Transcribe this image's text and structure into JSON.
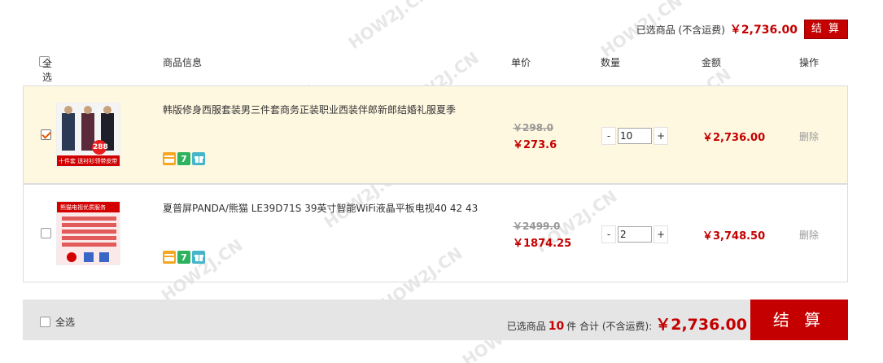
{
  "top_summary": {
    "label": "已选商品 (不含运费)",
    "amount": "￥2,736.00",
    "button": "结 算"
  },
  "header": {
    "select_all": "全选",
    "product_info": "商品信息",
    "unit_price": "单价",
    "quantity": "数量",
    "amount": "金额",
    "operation": "操作"
  },
  "items": [
    {
      "title": "韩版修身西服套装男三件套商务正装职业西装伴郎新郎结婚礼服夏季",
      "orig_price": "￥298.0",
      "price": "￥273.6",
      "qty": "10",
      "sum": "￥2,736.00",
      "delete": "删除",
      "checked": true,
      "thumb_text_1": "288",
      "thumb_text_2": "十件套 送衬衫领带皮带"
    },
    {
      "title": "夏普屏PANDA/熊猫 LE39D71S 39英寸智能WiFi液晶平板电视40 42 43",
      "orig_price": "￥2499.0",
      "price": "￥1874.25",
      "qty": "2",
      "sum": "￥3,748.50",
      "delete": "删除",
      "checked": false,
      "thumb_text_1": "熊猫电视优质服务"
    }
  ],
  "qty_minus": "-",
  "qty_plus": "+",
  "badges": {
    "seven": "7"
  },
  "bottom": {
    "select_all": "全选",
    "selected_prefix": "已选商品",
    "count": "10",
    "selected_suffix": "件 合计 (不含运费):",
    "total": "￥2,736.00",
    "button": "结 算"
  },
  "watermark": "HOW2J.CN",
  "colors": {
    "accent": "#c40000",
    "selected_row": "#fff8e1",
    "bottom_bar": "#e5e5e5"
  }
}
